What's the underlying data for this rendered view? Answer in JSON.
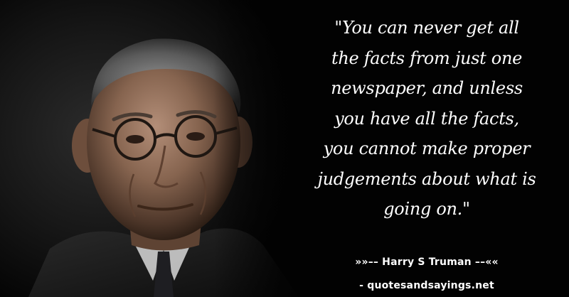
{
  "image": {
    "subject": "portrait-photo",
    "background_color": "#020202"
  },
  "quote": {
    "text": "\"You can never get all\nthe facts from just one\nnewspaper, and unless\nyou have all the facts,\nyou cannot make proper\njudgements about what is\ngoing on.\"",
    "color": "#ffffff"
  },
  "attribution": {
    "text": "»»–– Harry S Truman ––««"
  },
  "source": {
    "text": "- quotesandsayings.net"
  }
}
